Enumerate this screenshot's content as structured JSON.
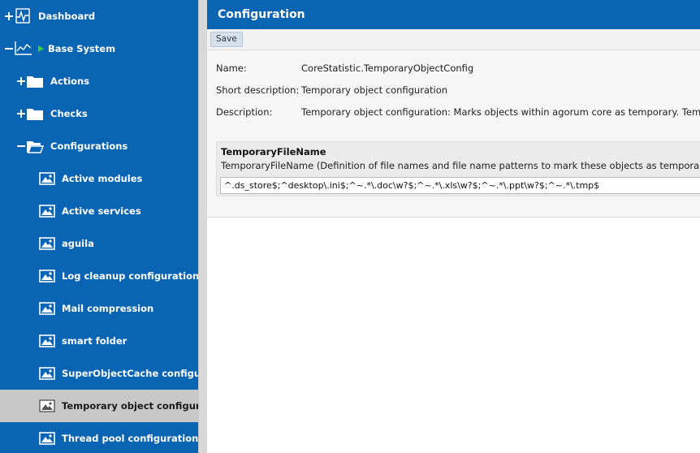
{
  "sidebar": {
    "items": [
      {
        "label": "Dashboard"
      },
      {
        "label": "Base System"
      },
      {
        "label": "Actions"
      },
      {
        "label": "Checks"
      },
      {
        "label": "Configurations"
      },
      {
        "label": "Active modules"
      },
      {
        "label": "Active services"
      },
      {
        "label": "aguila"
      },
      {
        "label": "Log cleanup configuration"
      },
      {
        "label": "Mail compression"
      },
      {
        "label": "smart folder"
      },
      {
        "label": "SuperObjectCache configura"
      },
      {
        "label": "Temporary object configurat"
      },
      {
        "label": "Thread pool configuration"
      }
    ],
    "selected_index": 12
  },
  "main": {
    "title": "Configuration",
    "toolbar": {
      "save_label": "Save"
    },
    "fields": {
      "name_label": "Name:",
      "name_value": "CoreStatistic.TemporaryObjectConfig",
      "short_desc_label": "Short description:",
      "short_desc_value": "Temporary object configuration",
      "desc_label": "Description:",
      "desc_value": "Temporary object configuration: Marks objects within agorum core as temporary. Temporary"
    },
    "parameter": {
      "title": "TemporaryFileName",
      "description": "TemporaryFileName (Definition of file names and file name patterns to mark these objects as temporary)",
      "value": "^.ds_store$;^desktop\\.ini$;^~.*\\.doc\\w?$;^~.*\\.xls\\w?$;^~.*\\.ppt\\w?$;^~.*\\.tmp$"
    }
  },
  "colors": {
    "sidebar_bg": "#0a64b4",
    "header_bg": "#0a64b4",
    "selected_bg": "#c8c8c8",
    "accent_green": "#38d13a"
  }
}
